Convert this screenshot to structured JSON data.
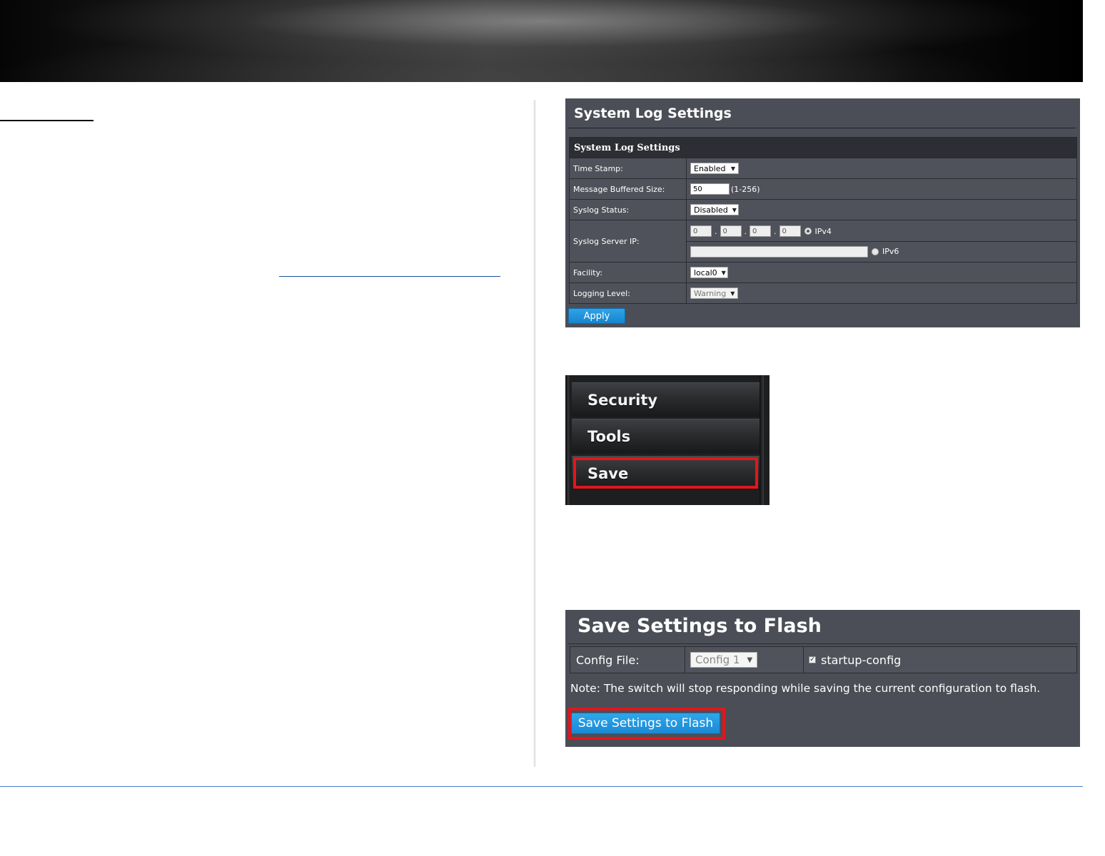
{
  "system_log_panel": {
    "title": "System Log Settings",
    "table_header": "System Log Settings",
    "rows": {
      "time_stamp": {
        "label": "Time Stamp:",
        "value": "Enabled"
      },
      "message_buffered_size": {
        "label": "Message Buffered Size:",
        "value": "50",
        "hint": "(1-256)"
      },
      "syslog_status": {
        "label": "Syslog Status:",
        "value": "Disabled"
      },
      "syslog_server_ip": {
        "label": "Syslog Server IP:",
        "octets": [
          "0",
          "0",
          "0",
          "0"
        ],
        "ipv4_label": "IPv4",
        "ipv6_value": "",
        "ipv6_label": "IPv6",
        "selected": "IPv4"
      },
      "facility": {
        "label": "Facility:",
        "value": "local0"
      },
      "logging_level": {
        "label": "Logging Level:",
        "value": "Warning"
      }
    },
    "apply_label": "Apply"
  },
  "side_menu": {
    "items": [
      {
        "label": "Security"
      },
      {
        "label": "Tools"
      },
      {
        "label": "Save",
        "highlighted": true
      }
    ],
    "highlight_color": "#e3151b"
  },
  "save_flash_panel": {
    "title": "Save Settings to Flash",
    "config_file_label": "Config File:",
    "config_file_value": "Config 1",
    "startup_config_label": "startup-config",
    "startup_config_checked": true,
    "note": "Note: The switch will stop responding while saving the current configuration to flash.",
    "button_label": "Save Settings to Flash"
  },
  "colors": {
    "panel_bg": "#4b4e56",
    "button_blue": "#1a89d4",
    "highlight_red": "#e3151b",
    "footer_rule": "#4a7cc9"
  },
  "icons": [
    "dropdown-arrow-icon",
    "radio-icon",
    "checkbox-icon"
  ]
}
